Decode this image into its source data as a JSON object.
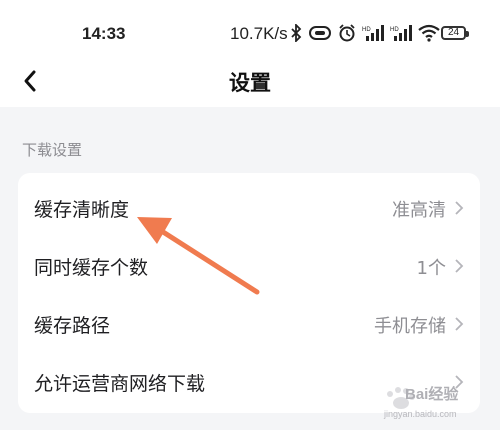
{
  "status_bar": {
    "time": "14:33",
    "network_speed": "10.7K/s",
    "battery": "24",
    "icons": [
      "bluetooth-icon",
      "vibrate-icon",
      "alarm-icon",
      "hd-signal-icon",
      "hd-signal-icon",
      "wifi-icon",
      "battery-icon"
    ]
  },
  "nav": {
    "title": "设置",
    "back_icon": "back-chevron-icon"
  },
  "section": {
    "label": "下载设置"
  },
  "settings": [
    {
      "label": "缓存清晰度",
      "value": "准高清"
    },
    {
      "label": "同时缓存个数",
      "value": "1个"
    },
    {
      "label": "缓存路径",
      "value": "手机存储"
    },
    {
      "label": "允许运营商网络下载",
      "value": ""
    }
  ],
  "annotation": {
    "arrow_color": "#f07b4f"
  },
  "watermark": {
    "brand": "Bai经验",
    "url": "jingyan.baidu.com"
  }
}
